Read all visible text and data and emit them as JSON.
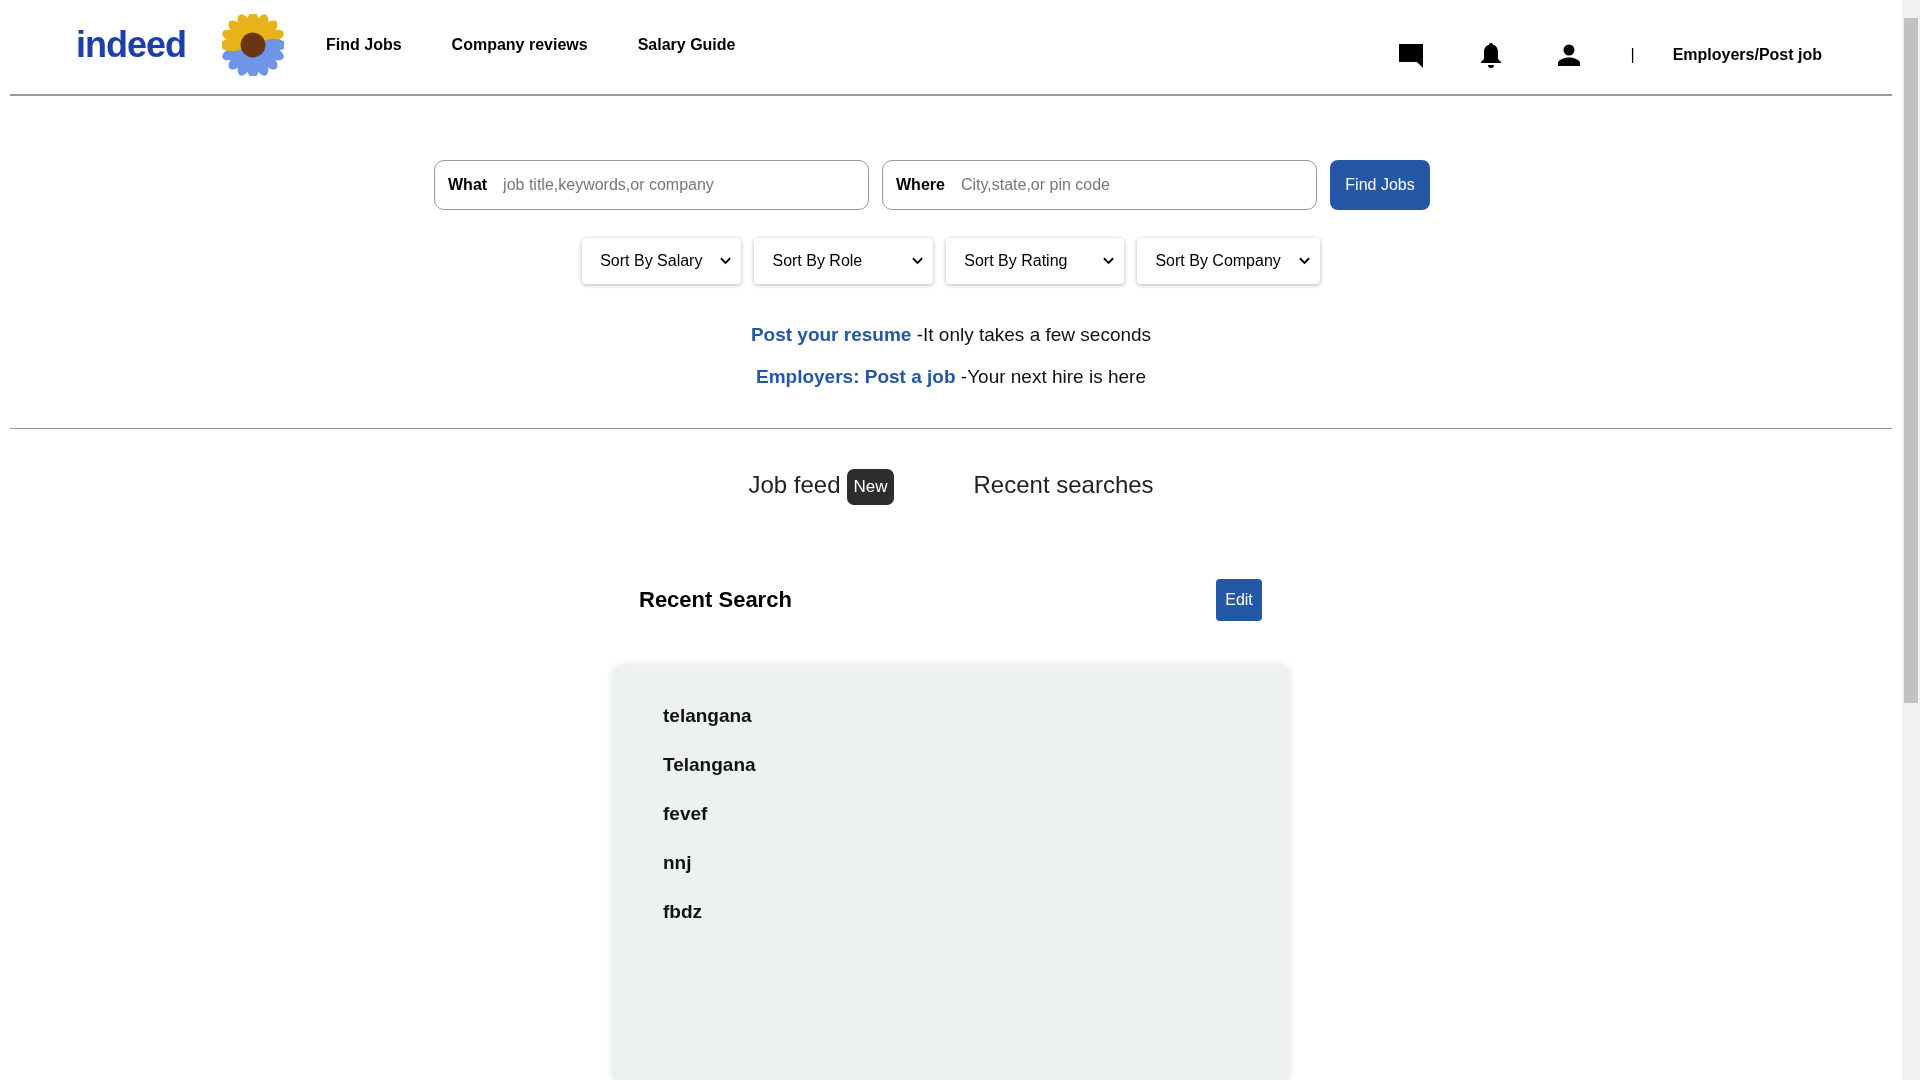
{
  "header": {
    "logo": "indeed",
    "nav": [
      "Find Jobs",
      "Company reviews",
      "Salary Guide"
    ],
    "separator": "|",
    "employer_link": "Employers/Post job"
  },
  "search": {
    "what": {
      "label": "What",
      "placeholder": "job title,keywords,or company"
    },
    "where": {
      "label": "Where",
      "placeholder": "City,state,or pin code"
    },
    "button": "Find Jobs"
  },
  "sorts": [
    "Sort By Salary",
    "Sort By Role",
    "Sort By Rating",
    "Sort By Company"
  ],
  "promos": [
    {
      "link": "Post your resume",
      "text": "-It only takes a few seconds"
    },
    {
      "link": "Employers: Post a job",
      "text": "-Your next hire is here"
    }
  ],
  "tabs": [
    {
      "label": "Job feed",
      "badge": "New"
    },
    {
      "label": "Recent searches"
    }
  ],
  "recent": {
    "title": "Recent Search",
    "edit_button": "Edit",
    "items": [
      "telangana",
      "Telangana",
      "fevef",
      "nnj",
      "fbdz"
    ]
  }
}
